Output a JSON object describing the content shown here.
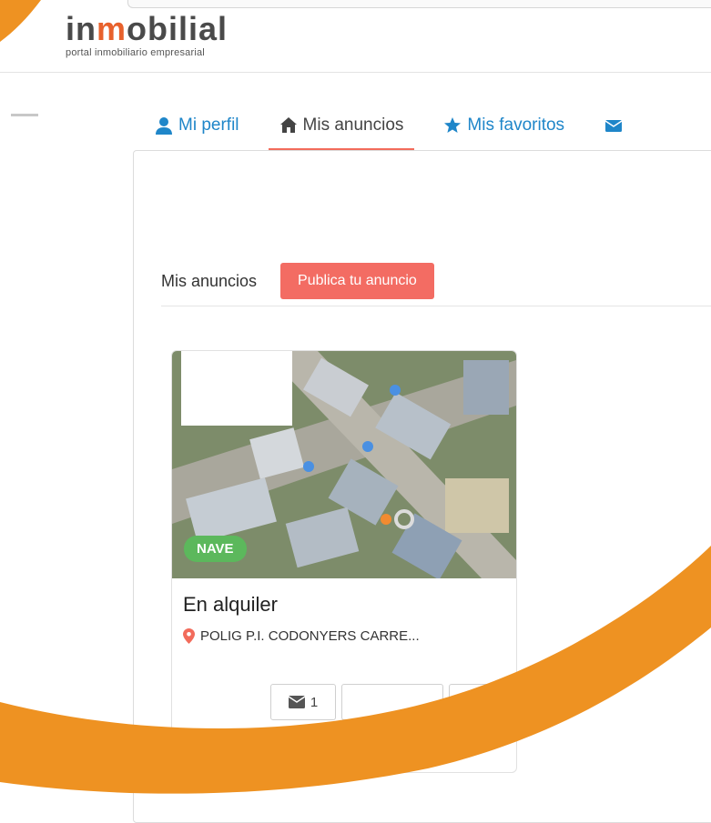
{
  "brand": {
    "logo_word_a": "in",
    "logo_word_b": "m",
    "logo_word_c": "obilial",
    "tagline": "portal inmobiliario empresarial",
    "accent_color": "#e8612c"
  },
  "tabs": [
    {
      "label": "Mi perfil",
      "icon": "user-icon",
      "active": false
    },
    {
      "label": "Mis anuncios",
      "icon": "home-icon",
      "active": true
    },
    {
      "label": "Mis favoritos",
      "icon": "star-icon",
      "active": false
    },
    {
      "label": "",
      "icon": "envelope-icon",
      "active": false
    }
  ],
  "section": {
    "title": "Mis anuncios",
    "publish_label": "Publica tu anuncio"
  },
  "listing": {
    "badge": "NAVE",
    "title": "En alquiler",
    "location": "POLIG P.I. CODONYERS CARRE...",
    "messages_count": "1",
    "image_icon": "aerial-map-image"
  },
  "colors": {
    "link_blue": "#1f86c9",
    "coral": "#f36c63",
    "badge_green": "#5cb85c",
    "swoosh_orange": "#ee9222"
  }
}
